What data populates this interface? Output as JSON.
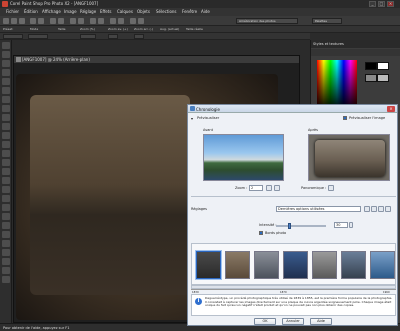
{
  "app": {
    "title": "Corel Paint Shop Pro Photo X2 - [ANGF1007]"
  },
  "menu": [
    "Fichier",
    "Édition",
    "Affichage",
    "Image",
    "Réglage",
    "Effets",
    "Calques",
    "Objets",
    "Sélections",
    "Fenêtre",
    "Aide"
  ],
  "toolbar": {
    "enhance_label": "Amélioration des photos",
    "palettes_label": "Palettes"
  },
  "options": {
    "presets": "Préset:",
    "mode": "Mode",
    "size": "Taille",
    "zoom": "Zoom (%)",
    "actual": "Zoom av. (+)",
    "zoom_out": "Zoom arr. (-)",
    "normal": "Aug. (actuel)",
    "fit": "Taille réelle"
  },
  "document": {
    "title": "[ANGF1007] @ 24% (Arrière-plan)"
  },
  "palette": {
    "title": "Styles et textures"
  },
  "status": {
    "text": "Pour obtenir de l'aide, appuyez sur F1"
  },
  "dialog": {
    "title": "Chronologie",
    "preview_toggle": "Prévisualiser",
    "preview_image_label": "Prévisualiser l'image",
    "before_label": "Avant",
    "after_label": "Après",
    "zoom_label": "Zoom :",
    "zoom_value": "2",
    "pan_label": "Panoramique :",
    "settings_label": "Réglages",
    "settings_value": "Dernières options utilisées",
    "intensity_label": "Intensité :",
    "intensity_value": "30",
    "border_label": "Bords photo",
    "year_start": "1839",
    "year_mid": "1870",
    "year_end": "1960",
    "description": "Daguerréotype, un procédé photographique très utilisé de 1839 à 1855, est la première forme populaire de la photographie. Il consistait à capturer les images directement sur une plaque de cuivre argentée soigneusement polie. Chaque image était unique du fait qu'aucun négatif n'était produit et qu'on ne pouvait pas non plus obtenir des copies.",
    "ok": "OK",
    "cancel": "Annuler",
    "help": "Aide"
  },
  "colors": {
    "accent": "#2f6fcf",
    "dialog_bg": "#eef1f6"
  }
}
